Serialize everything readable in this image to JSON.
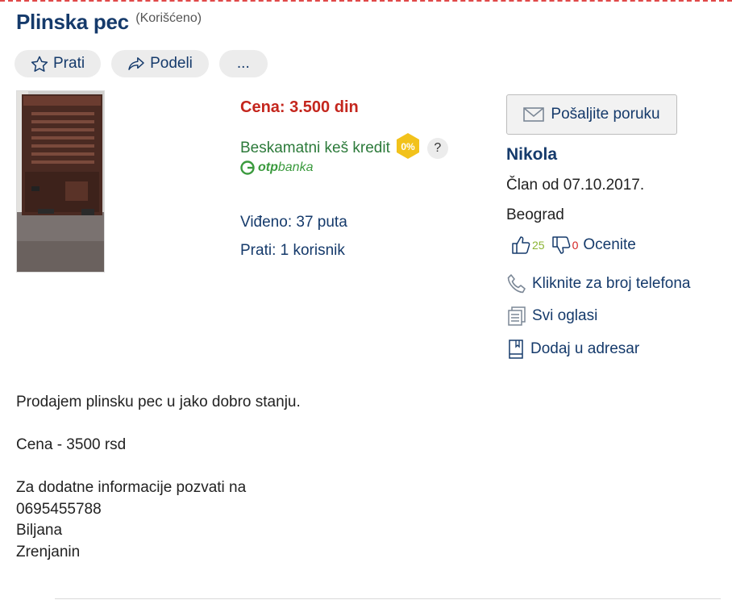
{
  "listing": {
    "title": "Plinska pec",
    "condition": "(Korišćeno)"
  },
  "actions": {
    "follow_label": "Prati",
    "share_label": "Podeli",
    "more_label": "..."
  },
  "details": {
    "price": "Cena: 3.500 din",
    "credit_label": "Beskamatni keš kredit",
    "credit_badge": "0%",
    "help_label": "?",
    "bank_logo_bold": "otp",
    "bank_logo_light": "banka",
    "views": "Viđeno: 37 puta",
    "followers": "Prati: 1 korisnik"
  },
  "seller": {
    "message_button": "Pošaljite poruku",
    "name": "Nikola",
    "member_since": "Član od 07.10.2017.",
    "city": "Beograd",
    "likes": "25",
    "dislikes": "0",
    "rate_label": "Ocenite",
    "phone_link": "Kliknite za broj telefona",
    "all_ads_link": "Svi oglasi",
    "address_book_link": "Dodaj u adresar"
  },
  "description": "Prodajem plinsku pec u jako dobro stanju.\n\nCena - 3500 rsd\n\nZa dodatne informacije pozvati na\n0695455788\nBiljana\nZrenjanin",
  "colors": {
    "brand_navy": "#153a6b",
    "price_red": "#c4261d",
    "credit_green": "#2c7a3a",
    "badge_yellow": "#f2c21b",
    "like_green": "#8bb433",
    "dislike_red": "#d42020"
  },
  "icons": [
    "star-icon",
    "share-icon",
    "envelope-icon",
    "thumbs-up-icon",
    "thumbs-down-icon",
    "phone-icon",
    "ads-list-icon",
    "address-book-icon",
    "otp-logo-icon"
  ]
}
